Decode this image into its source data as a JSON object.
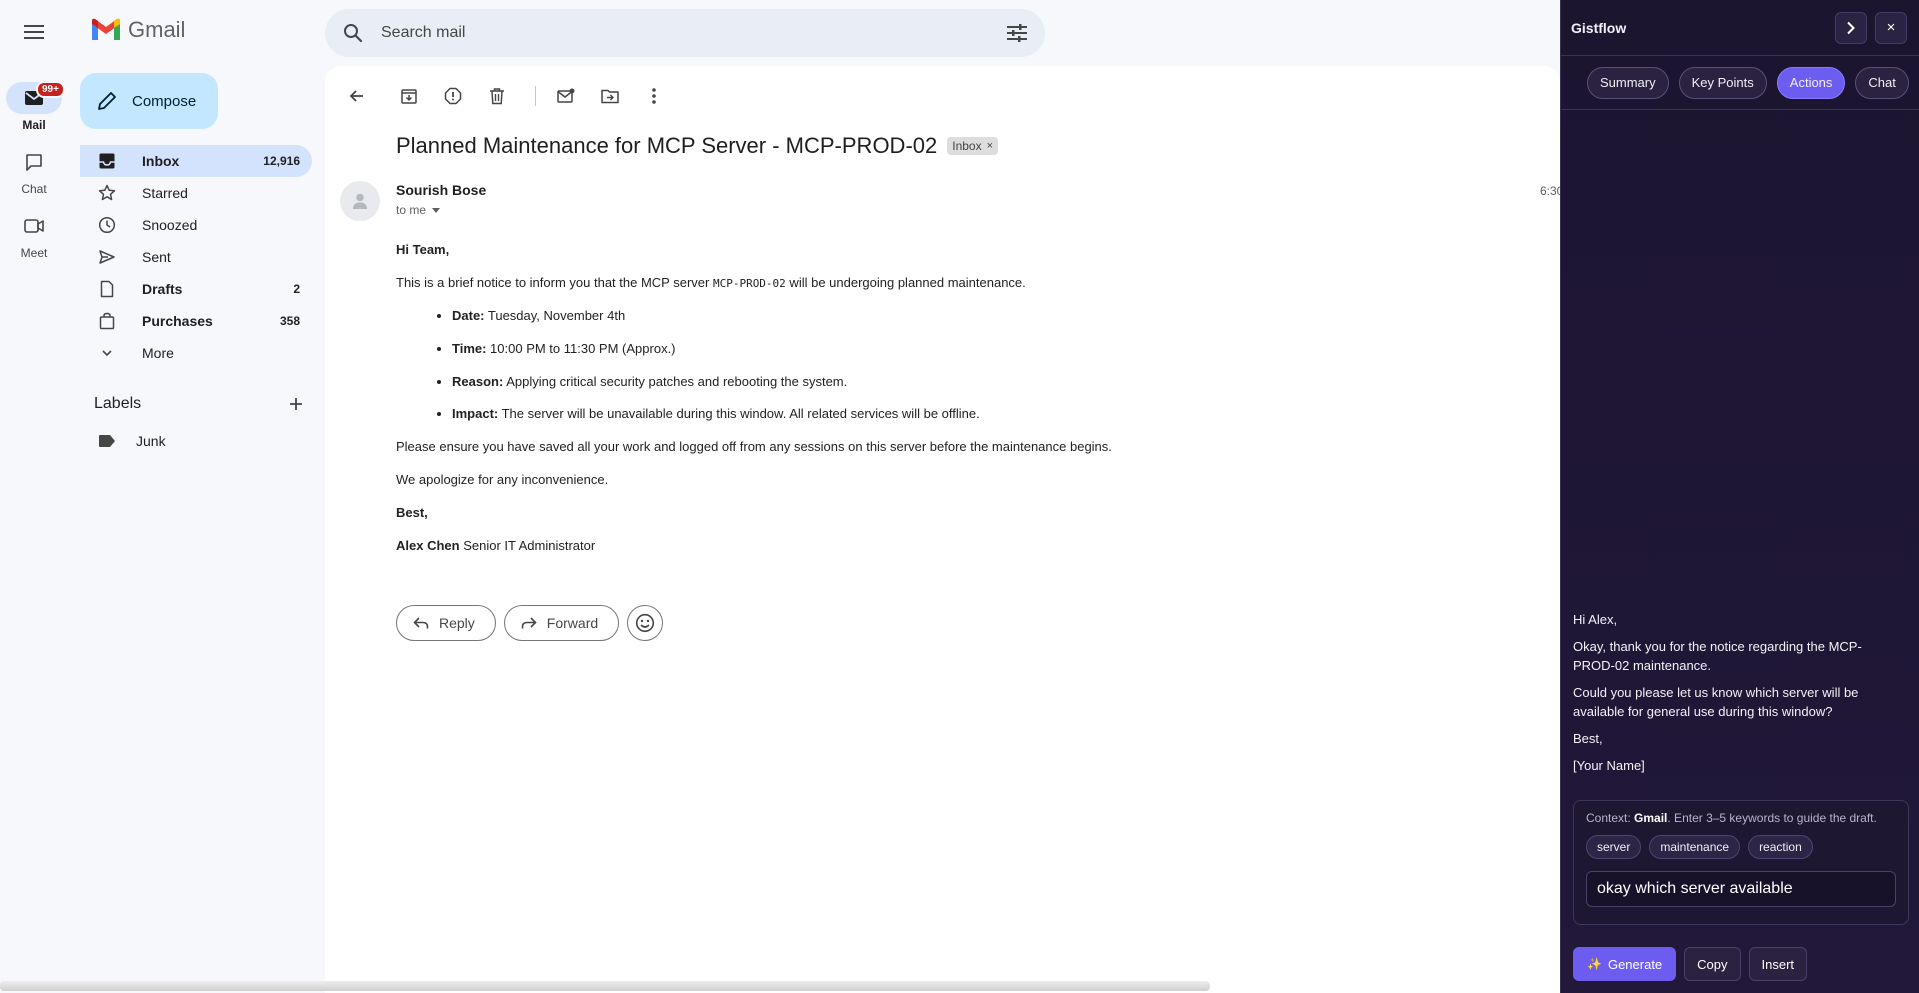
{
  "rail": {
    "items": [
      {
        "label": "Mail",
        "badge": "99+"
      },
      {
        "label": "Chat"
      },
      {
        "label": "Meet"
      }
    ]
  },
  "logo": {
    "text": "Gmail"
  },
  "search": {
    "placeholder": "Search mail"
  },
  "compose": {
    "label": "Compose"
  },
  "nav": {
    "items": [
      {
        "label": "Inbox",
        "count": "12,916"
      },
      {
        "label": "Starred",
        "count": ""
      },
      {
        "label": "Snoozed",
        "count": ""
      },
      {
        "label": "Sent",
        "count": ""
      },
      {
        "label": "Drafts",
        "count": "2"
      },
      {
        "label": "Purchases",
        "count": "358"
      },
      {
        "label": "More",
        "count": ""
      }
    ]
  },
  "labels": {
    "title": "Labels",
    "items": [
      "Junk"
    ]
  },
  "email": {
    "subject": "Planned Maintenance for MCP Server - MCP-PROD-02",
    "chip": "Inbox",
    "chip_close": "×",
    "sender": "Sourish Bose",
    "to": "to me",
    "time": "6:30",
    "greeting": "Hi Team,",
    "intro_before": "This is a brief notice to inform you that the MCP server ",
    "intro_code": "MCP-PROD-02",
    "intro_after": " will be undergoing planned maintenance.",
    "bullets": [
      {
        "label": "Date:",
        "text": " Tuesday, November 4th"
      },
      {
        "label": "Time:",
        "text": " 10:00 PM to 11:30 PM (Approx.)"
      },
      {
        "label": "Reason:",
        "text": " Applying critical security patches and rebooting the system."
      },
      {
        "label": "Impact:",
        "text": " The server will be unavailable during this window. All related services will be offline."
      }
    ],
    "para1": "Please ensure you have saved all your work and logged off from any sessions on this server before the maintenance begins.",
    "para2": "We apologize for any inconvenience.",
    "signoff": "Best,",
    "sig_name": "Alex Chen",
    "sig_title": " Senior IT Administrator",
    "reply_label": "Reply",
    "forward_label": "Forward"
  },
  "panel": {
    "title": "Gistflow",
    "close": "×",
    "tabs": [
      "Summary",
      "Key Points",
      "Actions",
      "Chat"
    ],
    "draft": [
      "Hi Alex,",
      "Okay, thank you for the notice regarding the MCP-PROD-02 maintenance.",
      "Could you please let us know which server will be available for general use during this window?",
      "Best,",
      "[Your Name]"
    ],
    "context_prefix": "Context: ",
    "context_app": "Gmail",
    "context_suffix": ". Enter 3–5 keywords to guide the draft.",
    "keywords": [
      "server",
      "maintenance",
      "reaction"
    ],
    "keyword_input": "okay which server available",
    "generate_label": "Generate",
    "copy_label": "Copy",
    "insert_label": "Insert"
  },
  "colors": {
    "accent": "#6d5cf0",
    "gmail_selected": "#d3e3fd",
    "compose_bg": "#c2e7ff",
    "badge": "#c5221f"
  }
}
